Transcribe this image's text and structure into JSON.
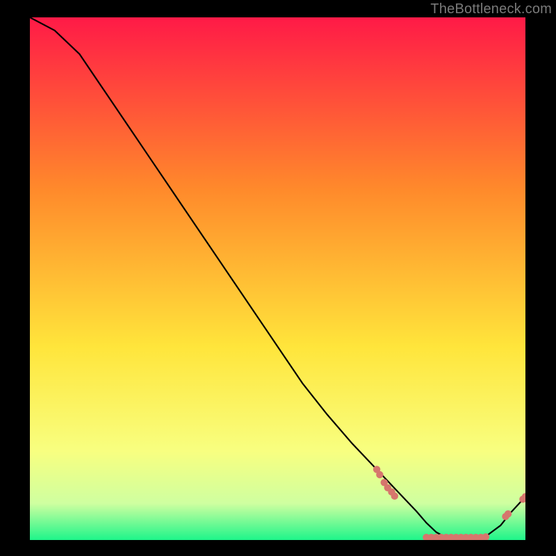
{
  "watermark": "TheBottleneck.com",
  "colors": {
    "page_bg": "#000000",
    "gradient_top": "#ff1a47",
    "gradient_mid1": "#ff8a2b",
    "gradient_mid2": "#ffe53b",
    "gradient_low1": "#f8ff80",
    "gradient_low2": "#cfffa0",
    "gradient_bottom": "#1ef58a",
    "curve": "#000000",
    "marker": "#d6766d"
  },
  "chart_data": {
    "type": "line",
    "title": "",
    "xlabel": "",
    "ylabel": "",
    "xlim": [
      0,
      100
    ],
    "ylim": [
      0,
      100
    ],
    "x": [
      0,
      5,
      10,
      15,
      20,
      25,
      30,
      35,
      40,
      45,
      50,
      55,
      60,
      65,
      70,
      75,
      78,
      80,
      82,
      84,
      86,
      88,
      90,
      92,
      95,
      97,
      100
    ],
    "values": [
      100,
      97.5,
      93,
      86,
      79,
      72,
      65,
      58,
      51,
      44,
      37,
      30,
      24,
      18.5,
      13.5,
      8.5,
      5.5,
      3.3,
      1.5,
      0.5,
      0.2,
      0.2,
      0.3,
      0.7,
      2.8,
      5.2,
      8.3
    ],
    "markers": [
      {
        "x": 70.0,
        "y": 13.5
      },
      {
        "x": 70.6,
        "y": 12.5
      },
      {
        "x": 71.5,
        "y": 11.0
      },
      {
        "x": 72.2,
        "y": 10.0
      },
      {
        "x": 73.0,
        "y": 9.2
      },
      {
        "x": 73.6,
        "y": 8.4
      },
      {
        "x": 80.0,
        "y": 0.5
      },
      {
        "x": 81.0,
        "y": 0.5
      },
      {
        "x": 82.0,
        "y": 0.5
      },
      {
        "x": 83.0,
        "y": 0.5
      },
      {
        "x": 84.0,
        "y": 0.5
      },
      {
        "x": 85.0,
        "y": 0.5
      },
      {
        "x": 86.0,
        "y": 0.5
      },
      {
        "x": 87.0,
        "y": 0.5
      },
      {
        "x": 88.0,
        "y": 0.5
      },
      {
        "x": 89.0,
        "y": 0.5
      },
      {
        "x": 90.0,
        "y": 0.5
      },
      {
        "x": 91.0,
        "y": 0.5
      },
      {
        "x": 92.0,
        "y": 0.6
      },
      {
        "x": 96.0,
        "y": 4.5
      },
      {
        "x": 96.5,
        "y": 5.0
      },
      {
        "x": 99.5,
        "y": 7.8
      },
      {
        "x": 100.0,
        "y": 8.3
      }
    ]
  }
}
